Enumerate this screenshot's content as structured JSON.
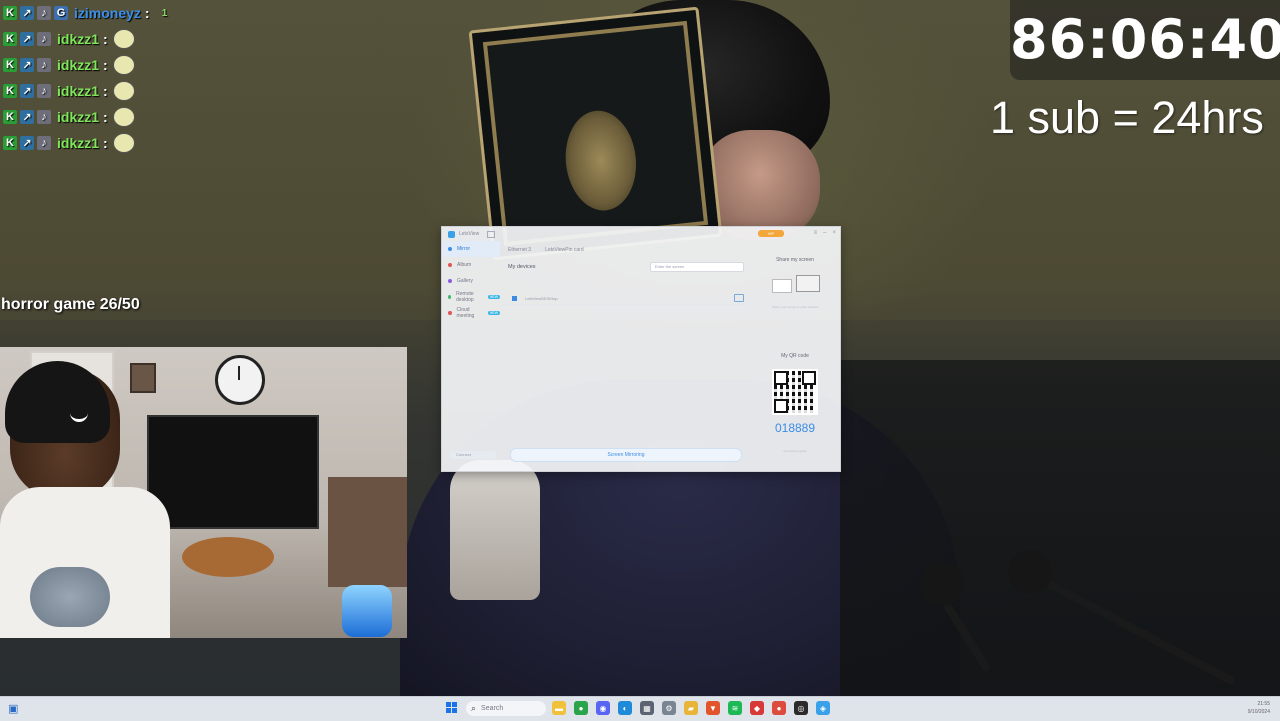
{
  "chat": {
    "messages": [
      {
        "user": "izimoneyz",
        "color": "#3a8fe8",
        "emote": "1"
      },
      {
        "user": "idkzz1",
        "color": "#7ee65a",
        "emote": ""
      },
      {
        "user": "idkzz1",
        "color": "#7ee65a",
        "emote": ""
      },
      {
        "user": "idkzz1",
        "color": "#7ee65a",
        "emote": ""
      },
      {
        "user": "idkzz1",
        "color": "#7ee65a",
        "emote": ""
      },
      {
        "user": "idkzz1",
        "color": "#7ee65a",
        "emote": ""
      }
    ],
    "colon": ":"
  },
  "overlay": {
    "horror_progress": "horror game 26/50",
    "timer": "86:06:40",
    "sub_rule": "1 sub = 24hrs"
  },
  "app": {
    "title": "LetsView",
    "vip_label": "VIP",
    "sidebar": [
      {
        "label": "Mirror",
        "active": true,
        "dot": "#3b8de6",
        "tag": ""
      },
      {
        "label": "Album",
        "active": false,
        "dot": "#e05656",
        "tag": ""
      },
      {
        "label": "Gallery",
        "active": false,
        "dot": "#8a5ce0",
        "tag": ""
      },
      {
        "label": "Remote desktop",
        "active": false,
        "dot": "#3fb86a",
        "tag": "NEW"
      },
      {
        "label": "Cloud meeting",
        "active": false,
        "dot": "#e05656",
        "tag": "NEW"
      }
    ],
    "sidebar_bottom": "Connect",
    "tabs": [
      "Ethernet 3",
      "LetsViewPin card"
    ],
    "my_devices": "My devices",
    "find_placeholder": "Enter the screen",
    "device_name": "LetsViewDESKtop",
    "mirror_button": "Screen Mirroring",
    "share_title": "Share my screen",
    "share_desc": "Share your screen to other devices",
    "qr_label": "My QR code",
    "qr_code": "018889",
    "qr_footer": "Connection guide"
  },
  "taskbar": {
    "search_placeholder": "Search",
    "time": "21:55",
    "date": "9/10/2024",
    "apps": [
      {
        "name": "file-explorer-icon",
        "color": "#f2c13c",
        "glyph": "▬"
      },
      {
        "name": "chrome-icon",
        "color": "#2aa34a",
        "glyph": "●"
      },
      {
        "name": "discord-icon",
        "color": "#5865f2",
        "glyph": "◉"
      },
      {
        "name": "edge-icon",
        "color": "#1f8ad8",
        "glyph": "◐"
      },
      {
        "name": "calculator-icon",
        "color": "#5b6470",
        "glyph": "▦"
      },
      {
        "name": "settings-icon",
        "color": "#7a8492",
        "glyph": "⚙"
      },
      {
        "name": "folder-icon",
        "color": "#e8b53a",
        "glyph": "▰"
      },
      {
        "name": "brave-icon",
        "color": "#e2542b",
        "glyph": "▼"
      },
      {
        "name": "spotify-icon",
        "color": "#1db954",
        "glyph": "≋"
      },
      {
        "name": "shield-icon",
        "color": "#d93838",
        "glyph": "◆"
      },
      {
        "name": "chrome-alt-icon",
        "color": "#dd4b3e",
        "glyph": "●"
      },
      {
        "name": "obs-icon",
        "color": "#2b2b2b",
        "glyph": "◎"
      },
      {
        "name": "letsview-icon",
        "color": "#3aa0e8",
        "glyph": "◈"
      }
    ]
  }
}
